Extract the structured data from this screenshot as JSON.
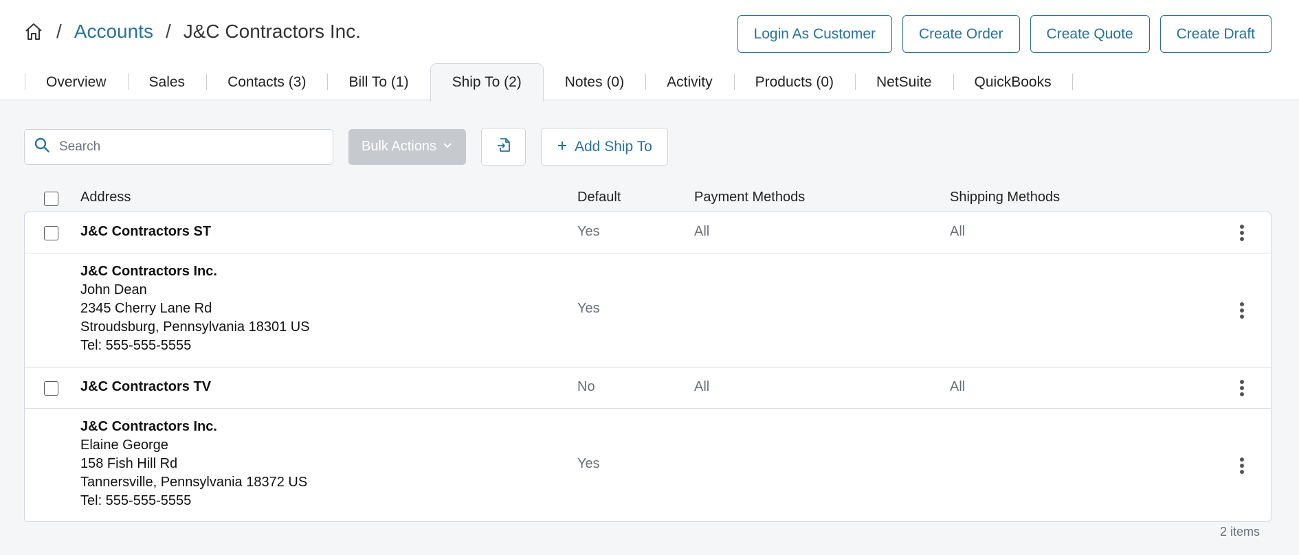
{
  "breadcrumb": {
    "home_icon": "home-icon",
    "separator": "/",
    "accounts_link": "Accounts",
    "current": "J&C Contractors Inc."
  },
  "actions": {
    "login_as_customer": "Login As Customer",
    "create_order": "Create Order",
    "create_quote": "Create Quote",
    "create_draft": "Create Draft"
  },
  "tabs": [
    {
      "label": "Overview"
    },
    {
      "label": "Sales"
    },
    {
      "label": "Contacts (3)"
    },
    {
      "label": "Bill To (1)"
    },
    {
      "label": "Ship To (2)"
    },
    {
      "label": "Notes (0)"
    },
    {
      "label": "Activity"
    },
    {
      "label": "Products (0)"
    },
    {
      "label": "NetSuite"
    },
    {
      "label": "QuickBooks"
    }
  ],
  "active_tab": "Ship To (2)",
  "toolbar": {
    "search_placeholder": "Search",
    "bulk_actions_label": "Bulk Actions",
    "import_icon": "file-import-icon",
    "add_ship_to_label": "Add Ship To",
    "add_icon": "plus-icon"
  },
  "columns": {
    "address": "Address",
    "default": "Default",
    "payment_methods": "Payment Methods",
    "shipping_methods": "Shipping Methods"
  },
  "rows": [
    {
      "name": "J&C Contractors ST",
      "default": "Yes",
      "payment_methods": "All",
      "shipping_methods": "All",
      "detail": {
        "company": "J&C Contractors Inc.",
        "contact": "John Dean",
        "street": "2345 Cherry Lane Rd",
        "city_line": "Stroudsburg, Pennsylvania 18301 US",
        "tel": "Tel: 555-555-5555",
        "default": "Yes"
      }
    },
    {
      "name": "J&C Contractors TV",
      "default": "No",
      "payment_methods": "All",
      "shipping_methods": "All",
      "detail": {
        "company": "J&C Contractors Inc.",
        "contact": "Elaine George",
        "street": "158 Fish Hill Rd",
        "city_line": "Tannersville, Pennsylvania 18372 US",
        "tel": "Tel: 555-555-5555",
        "default": "Yes"
      }
    }
  ],
  "item_count": "2 items",
  "colors": {
    "accent": "#27719e",
    "muted_text": "#6b7078",
    "background": "#f5f6f8",
    "disabled_button": "#c6c9ce"
  }
}
